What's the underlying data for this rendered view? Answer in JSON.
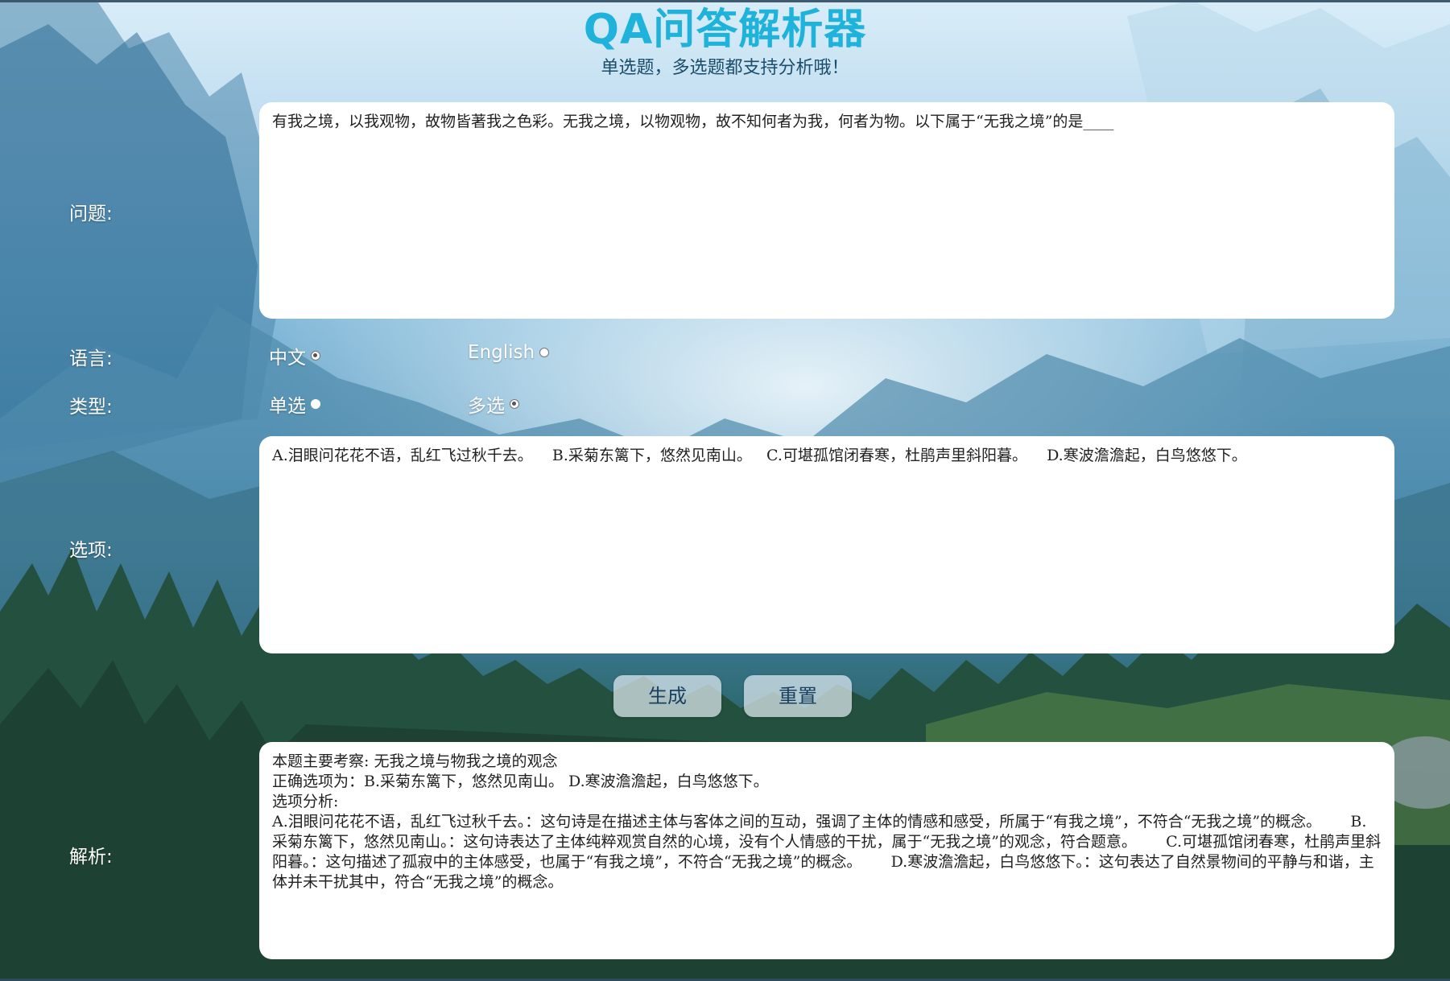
{
  "header": {
    "title": "QA问答解析器",
    "subtitle": "单选题，多选题都支持分析哦！"
  },
  "question": {
    "label": "问题:",
    "value": "有我之境，以我观物，故物皆著我之色彩。无我之境，以物观物，故不知何者为我，何者为物。以下属于“无我之境”的是____"
  },
  "language": {
    "label": "语言:",
    "options": [
      {
        "label": "中文",
        "checked": true
      },
      {
        "label": "English",
        "checked": false
      }
    ]
  },
  "type": {
    "label": "类型:",
    "options": [
      {
        "label": "单选",
        "checked": false
      },
      {
        "label": "多选",
        "checked": true
      }
    ]
  },
  "options": {
    "label": "选项:",
    "value": "A.泪眼问花花不语，乱红飞过秋千去。    B.采菊东篱下，悠然见南山。   C.可堪孤馆闭春寒，杜鹃声里斜阳暮。    D.寒波澹澹起，白鸟悠悠下。"
  },
  "buttons": {
    "generate": "生成",
    "reset": "重置"
  },
  "analysis": {
    "label": "解析:",
    "value": "本题主要考察: 无我之境与物我之境的观念\n正确选项为：B.采菊东篱下，悠然见南山。 D.寒波澹澹起，白鸟悠悠下。\n选项分析:\nA.泪眼问花花不语，乱红飞过秋千去。：这句诗是在描述主体与客体之间的互动，强调了主体的情感和感受，所属于“有我之境”，不符合“无我之境”的概念。      B.采菊东篱下，悠然见南山。：这句诗表达了主体纯粹观赏自然的心境，没有个人情感的干扰，属于“无我之境”的观念，符合题意。      C.可堪孤馆闭春寒，杜鹃声里斜阳暮。：这句描述了孤寂中的主体感受，也属于“有我之境”，不符合“无我之境”的概念。      D.寒波澹澹起，白鸟悠悠下。：这句表达了自然景物间的平静与和谐，主体并未干扰其中，符合“无我之境”的概念。"
  },
  "colors": {
    "title": "#1fb3dc",
    "subtitle": "#1b4d6b",
    "label": "#ffffff",
    "box_bg": "#ffffff"
  }
}
